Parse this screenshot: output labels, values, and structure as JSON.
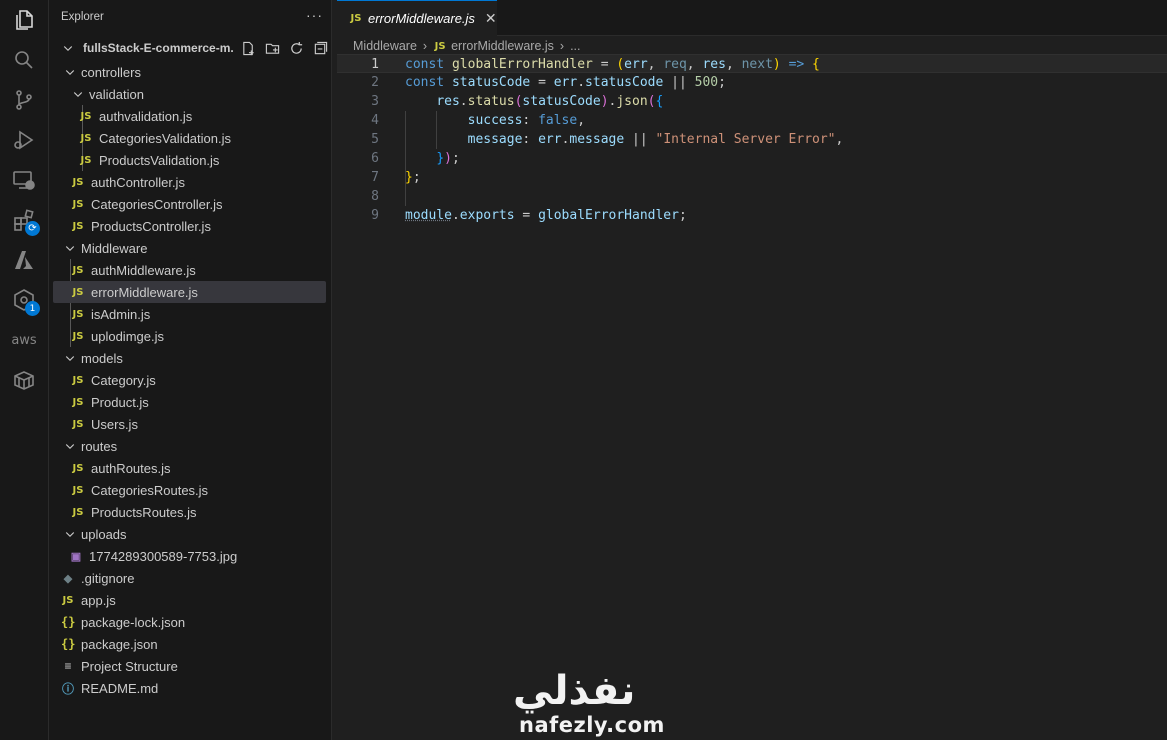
{
  "activity_bar": {
    "items": [
      {
        "name": "explorer-icon"
      },
      {
        "name": "search-icon"
      },
      {
        "name": "source-control-icon"
      },
      {
        "name": "run-debug-icon"
      },
      {
        "name": "remote-explorer-icon"
      },
      {
        "name": "extensions-icon"
      },
      {
        "name": "azure-icon"
      },
      {
        "name": "gitlens-icon",
        "badge": "1"
      },
      {
        "name": "aws-icon",
        "text": "aws"
      },
      {
        "name": "containers-icon"
      }
    ]
  },
  "sidebar": {
    "title": "Explorer",
    "more": "···",
    "root": {
      "label": "fullsStack-E-commerce-m..."
    },
    "tree": [
      {
        "label": "controllers",
        "type": "folder",
        "depth": 1
      },
      {
        "label": "validation",
        "type": "folder",
        "depth": 2
      },
      {
        "label": "authvalidation.js",
        "type": "js",
        "depth": 3
      },
      {
        "label": "CategoriesValidation.js",
        "type": "js",
        "depth": 3
      },
      {
        "label": "ProductsValidation.js",
        "type": "js",
        "depth": 3
      },
      {
        "label": "authController.js",
        "type": "js",
        "depth": 2
      },
      {
        "label": "CategoriesController.js",
        "type": "js",
        "depth": 2
      },
      {
        "label": "ProductsController.js",
        "type": "js",
        "depth": 2
      },
      {
        "label": "Middleware",
        "type": "folder",
        "depth": 1
      },
      {
        "label": "authMiddleware.js",
        "type": "js",
        "depth": 2
      },
      {
        "label": "errorMiddleware.js",
        "type": "js",
        "depth": 2,
        "selected": true
      },
      {
        "label": "isAdmin.js",
        "type": "js",
        "depth": 2
      },
      {
        "label": "uplodimge.js",
        "type": "js",
        "depth": 2
      },
      {
        "label": "models",
        "type": "folder",
        "depth": 1
      },
      {
        "label": "Category.js",
        "type": "js",
        "depth": 2
      },
      {
        "label": "Product.js",
        "type": "js",
        "depth": 2
      },
      {
        "label": "Users.js",
        "type": "js",
        "depth": 2
      },
      {
        "label": "routes",
        "type": "folder",
        "depth": 1
      },
      {
        "label": "authRoutes.js",
        "type": "js",
        "depth": 2
      },
      {
        "label": "CategoriesRoutes.js",
        "type": "js",
        "depth": 2
      },
      {
        "label": "ProductsRoutes.js",
        "type": "js",
        "depth": 2
      },
      {
        "label": "uploads",
        "type": "folder",
        "depth": 1
      },
      {
        "label": "1774289300589-7753.jpg",
        "type": "img",
        "depth": 2
      },
      {
        "label": ".gitignore",
        "type": "git",
        "depth": 1
      },
      {
        "label": "app.js",
        "type": "js",
        "depth": 1
      },
      {
        "label": "package-lock.json",
        "type": "json",
        "depth": 1
      },
      {
        "label": "package.json",
        "type": "json",
        "depth": 1
      },
      {
        "label": "Project Structure",
        "type": "txt",
        "depth": 1
      },
      {
        "label": "README.md",
        "type": "info",
        "depth": 1
      }
    ]
  },
  "editor": {
    "tab": {
      "icon": "JS",
      "label": "errorMiddleware.js",
      "close": "✕"
    },
    "breadcrumb": {
      "folder": "Middleware",
      "file": "errorMiddleware.js",
      "more": "..."
    },
    "lines": [
      {
        "n": "1",
        "current": true
      },
      {
        "n": "2"
      },
      {
        "n": "3"
      },
      {
        "n": "4"
      },
      {
        "n": "5"
      },
      {
        "n": "6"
      },
      {
        "n": "7"
      },
      {
        "n": "8"
      },
      {
        "n": "9"
      }
    ]
  },
  "icons": {
    "js": "JS",
    "json": "{}",
    "git": "◆",
    "img": "▣",
    "txt": "≡",
    "info": "ⓘ"
  },
  "watermark": {
    "arabic": "نفذلي",
    "latin": "nafezly.com"
  },
  "colors": {
    "accent": "#0078d4",
    "keyword": "#569cd6",
    "function": "#dcdcaa",
    "variable": "#9cdcfe",
    "string": "#ce9178",
    "number": "#b5cea8",
    "js_icon": "#cbcb41"
  }
}
